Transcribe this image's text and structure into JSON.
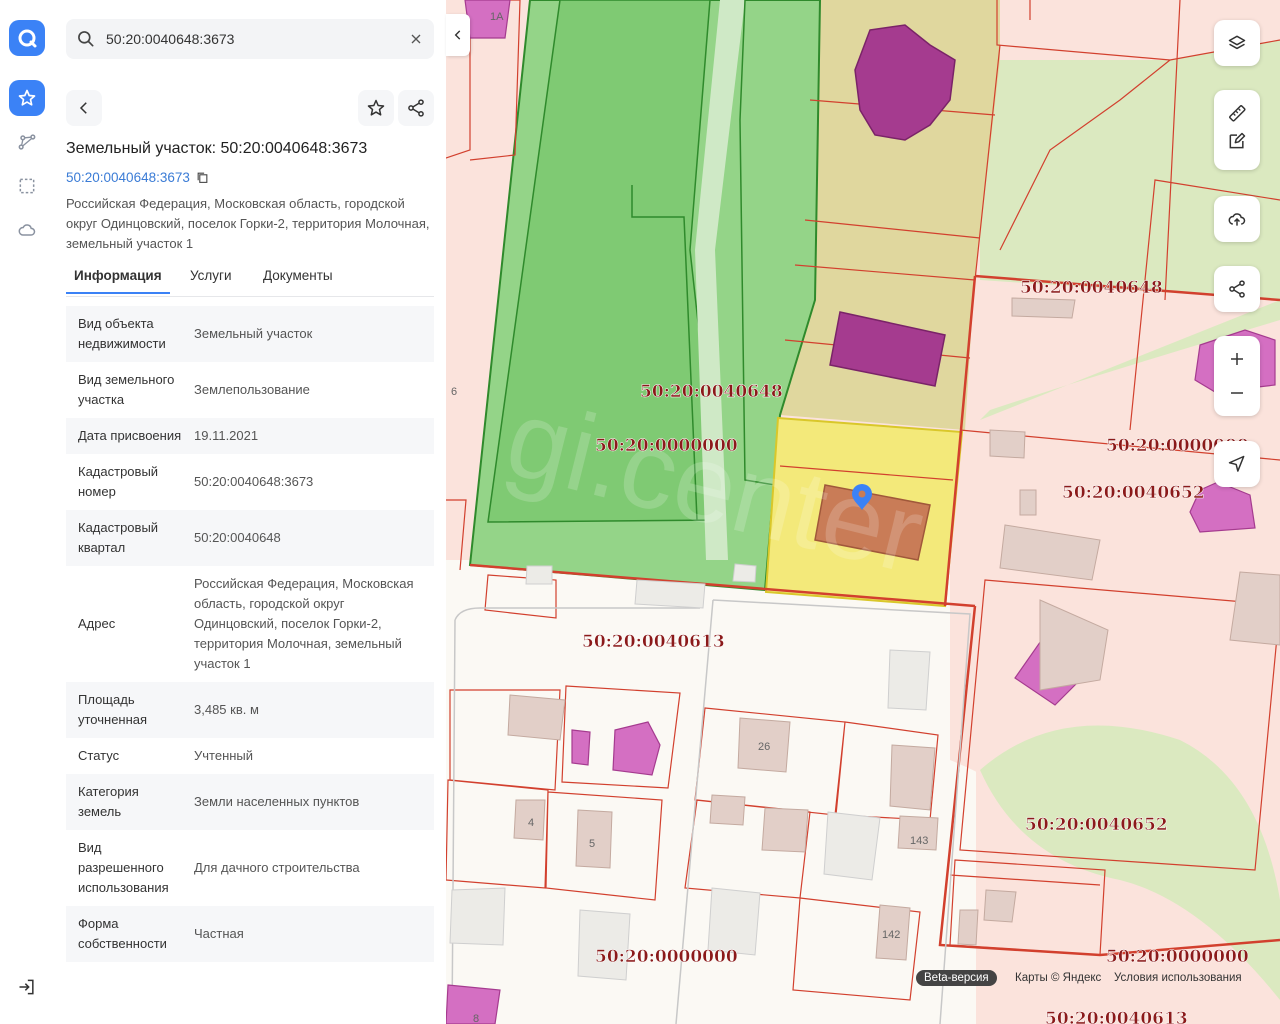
{
  "search": {
    "value": "50:20:0040648:3673",
    "icon": "search-icon"
  },
  "parcel": {
    "title": "Земельный участок: 50:20:0040648:3673",
    "cad_link": "50:20:0040648:3673",
    "address": "Российская Федерация, Московская область, городской округ Одинцовский, поселок Горки-2, территория Молочная, земельный участок 1"
  },
  "tabs": [
    {
      "label": "Информация"
    },
    {
      "label": "Услуги"
    },
    {
      "label": "Документы"
    }
  ],
  "info": [
    {
      "label": "Вид объекта недвижимости",
      "value": "Земельный участок"
    },
    {
      "label": "Вид земельного участка",
      "value": "Землепользование"
    },
    {
      "label": "Дата присвоения",
      "value": "19.11.2021"
    },
    {
      "label": "Кадастровый номер",
      "value": "50:20:0040648:3673"
    },
    {
      "label": "Кадастровый квартал",
      "value": "50:20:0040648"
    },
    {
      "label": "Адрес",
      "value": "Российская Федерация, Московская область, городской округ Одинцовский, поселок Горки-2, территория Молочная, земельный участок 1"
    },
    {
      "label": "Площадь уточненная",
      "value": "3,485 кв. м"
    },
    {
      "label": "Статус",
      "value": "Учтенный"
    },
    {
      "label": "Категория земель",
      "value": "Земли населенных пунктов"
    },
    {
      "label": "Вид разрешенного использования",
      "value": "Для дачного строительства"
    },
    {
      "label": "Форма собственности",
      "value": "Частная"
    }
  ],
  "map": {
    "labels": [
      "50:20:0040648",
      "50:20:0040648",
      "50:20:0000000",
      "50:20:0000000",
      "50:20:0040652",
      "50:20:0040613",
      "50:20:0040652",
      "50:20:0000000",
      "50:20:0000000",
      "50:20:0040613"
    ],
    "house_numbers": [
      "1А",
      "6",
      "26",
      "4",
      "5",
      "143",
      "142",
      "8"
    ],
    "watermark": "gi.center",
    "beta": "Beta-версия",
    "attribution": "Карты © Яндекс",
    "terms": "Условия использования"
  },
  "colors": {
    "accent": "#3b82f6",
    "border": "#d2402e",
    "label": "#8b1a1a",
    "selected": "#f0e26a",
    "forest": "#8fd283",
    "building": "#a53b8f"
  }
}
